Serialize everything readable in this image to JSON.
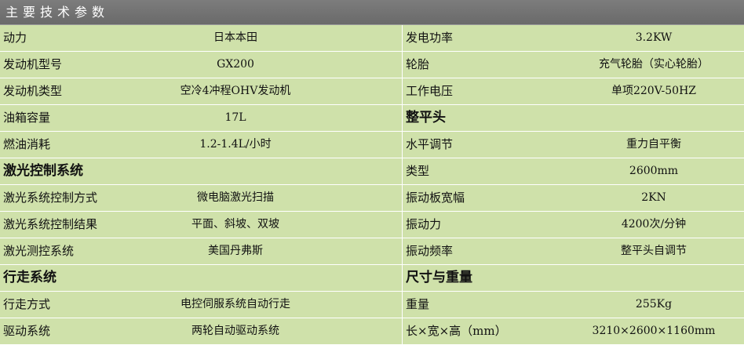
{
  "header": {
    "title": "主要技术参数"
  },
  "left_rows": [
    {
      "label": "动力",
      "value": "日本本田",
      "section": false
    },
    {
      "label": "发动机型号",
      "value": "GX200",
      "section": false
    },
    {
      "label": "发动机类型",
      "value": "空冷4冲程OHV发动机",
      "section": false
    },
    {
      "label": "油箱容量",
      "value": "17L",
      "section": false
    },
    {
      "label": "燃油消耗",
      "value": "1.2-1.4L/小时",
      "section": false
    },
    {
      "label": "激光控制系统",
      "value": "",
      "section": true
    },
    {
      "label": "激光系统控制方式",
      "value": "微电脑激光扫描",
      "section": false
    },
    {
      "label": "激光系统控制结果",
      "value": "平面、斜坡、双坡",
      "section": false
    },
    {
      "label": "激光测控系统",
      "value": "美国丹弗斯",
      "section": false
    },
    {
      "label": "行走系统",
      "value": "",
      "section": true
    },
    {
      "label": "行走方式",
      "value": "电控伺服系统自动行走",
      "section": false
    },
    {
      "label": "驱动系统",
      "value": "两轮自动驱动系统",
      "section": false
    }
  ],
  "right_rows": [
    {
      "label": "发电功率",
      "value": "3.2KW",
      "section": false
    },
    {
      "label": "轮胎",
      "value": "充气轮胎（实心轮胎）",
      "section": false
    },
    {
      "label": "工作电压",
      "value": "单项220V-50HZ",
      "section": false
    },
    {
      "label": "整平头",
      "value": "",
      "section": true
    },
    {
      "label": "水平调节",
      "value": "重力自平衡",
      "section": false
    },
    {
      "label": "类型",
      "value": "2600mm",
      "section": false
    },
    {
      "label": "振动板宽幅",
      "value": "2KN",
      "section": false
    },
    {
      "label": "振动力",
      "value": "4200次/分钟",
      "section": false
    },
    {
      "label": "振动频率",
      "value": "整平头自调节",
      "section": false
    },
    {
      "label": "尺寸与重量",
      "value": "",
      "section": true
    },
    {
      "label": "重量",
      "value": "255Kg",
      "section": false
    },
    {
      "label": "长×宽×高（mm）",
      "value": "3210×2600×1160mm",
      "section": false
    }
  ]
}
